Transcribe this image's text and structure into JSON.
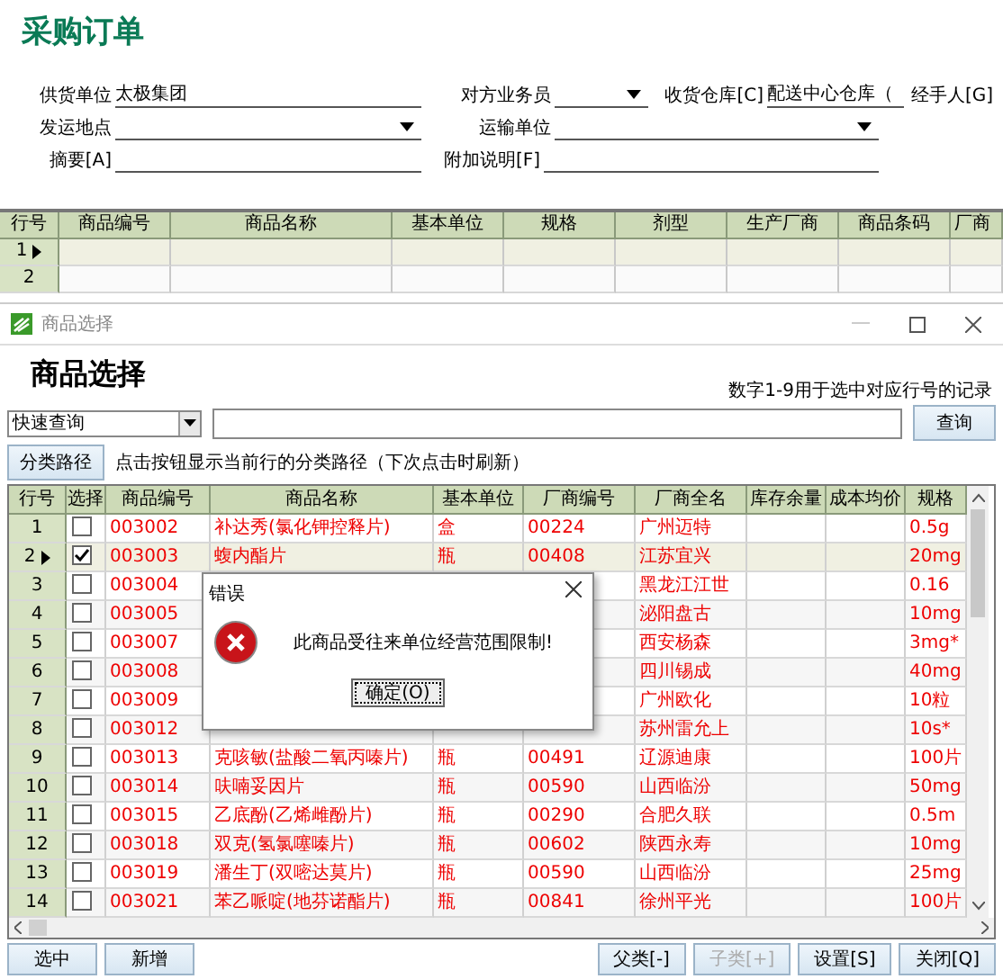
{
  "page_title": "采购订单",
  "form_rows": [
    [
      {
        "label": "供货单位",
        "value": "太极集团",
        "kind": "text"
      },
      {
        "label": "对方业务员",
        "kind": "dropdown"
      },
      {
        "label": "收货仓库[C]",
        "value": "配送中心仓库（",
        "kind": "text"
      },
      {
        "label": "经手人[G]",
        "kind": "cut"
      }
    ],
    [
      {
        "label": "发运地点",
        "kind": "dropdown"
      },
      {
        "label": "运输单位",
        "kind": "dropdown"
      }
    ],
    [
      {
        "label": "摘要[A]",
        "kind": "text"
      },
      {
        "label": "附加说明[F]",
        "kind": "text"
      }
    ]
  ],
  "order_grid": {
    "columns": [
      "行号",
      "商品编号",
      "商品名称",
      "基本单位",
      "规格",
      "剂型",
      "生产厂商",
      "商品条码",
      "厂商"
    ],
    "rows": [
      {
        "row": "1",
        "selected": true
      },
      {
        "row": "2",
        "selected": false
      }
    ]
  },
  "picker_window": {
    "title": "商品选择",
    "heading": "商品选择",
    "hint": "数字1-9用于选中对应行号的记录",
    "search_mode": "快速查询",
    "search_button": "查询",
    "category_button": "分类路径",
    "category_hint": "点击按钮显示当前行的分类路径（下次点击时刷新）",
    "columns": [
      "行号",
      "选择",
      "商品编号",
      "商品名称",
      "基本单位",
      "厂商编号",
      "厂商全名",
      "库存余量",
      "成本均价",
      "规格"
    ],
    "rows": [
      {
        "row": "1",
        "checked": false,
        "selected": false,
        "code": "003002",
        "name": "补达秀(氯化钾控释片)",
        "unit": "盒",
        "vendor_code": "00224",
        "vendor": "广州迈特",
        "spec": "0.5g"
      },
      {
        "row": "2",
        "checked": true,
        "selected": true,
        "code": "003003",
        "name": "蝮内酯片",
        "unit": "瓶",
        "vendor_code": "00408",
        "vendor": "江苏宜兴",
        "spec": "20mg"
      },
      {
        "row": "3",
        "checked": false,
        "selected": false,
        "code": "003004",
        "vendor": "黑龙江江世",
        "spec": "0.16"
      },
      {
        "row": "4",
        "checked": false,
        "selected": false,
        "code": "003005",
        "vendor": "泌阳盘古",
        "spec": "10mg"
      },
      {
        "row": "5",
        "checked": false,
        "selected": false,
        "code": "003007",
        "vendor": "西安杨森",
        "spec": "3mg*"
      },
      {
        "row": "6",
        "checked": false,
        "selected": false,
        "code": "003008",
        "vendor": "四川锡成",
        "spec": "40mg"
      },
      {
        "row": "7",
        "checked": false,
        "selected": false,
        "code": "003009",
        "vendor": "广州欧化",
        "spec": "10粒"
      },
      {
        "row": "8",
        "checked": false,
        "selected": false,
        "code": "003012",
        "vendor": "苏州雷允上",
        "spec": "10s*"
      },
      {
        "row": "9",
        "checked": false,
        "selected": false,
        "code": "003013",
        "name": "克咳敏(盐酸二氧丙嗪片)",
        "unit": "瓶",
        "vendor_code": "00491",
        "vendor": "辽源迪康",
        "spec": "100片"
      },
      {
        "row": "10",
        "checked": false,
        "selected": false,
        "code": "003014",
        "name": "呋喃妥因片",
        "unit": "瓶",
        "vendor_code": "00590",
        "vendor": "山西临汾",
        "spec": "50mg"
      },
      {
        "row": "11",
        "checked": false,
        "selected": false,
        "code": "003015",
        "name": "乙底酚(乙烯雌酚片)",
        "unit": "瓶",
        "vendor_code": "00290",
        "vendor": "合肥久联",
        "spec": "0.5m"
      },
      {
        "row": "12",
        "checked": false,
        "selected": false,
        "code": "003018",
        "name": "双克(氢氯噻嗪片)",
        "unit": "瓶",
        "vendor_code": "00602",
        "vendor": "陕西永寿",
        "spec": "10mg"
      },
      {
        "row": "13",
        "checked": false,
        "selected": false,
        "code": "003019",
        "name": "潘生丁(双嘧达莫片)",
        "unit": "瓶",
        "vendor_code": "00590",
        "vendor": "山西临汾",
        "spec": "25mg"
      },
      {
        "row": "14",
        "checked": false,
        "selected": false,
        "code": "003021",
        "name": "苯乙哌啶(地芬诺酯片)",
        "unit": "瓶",
        "vendor_code": "00841",
        "vendor": "徐州平光",
        "spec": "100片"
      }
    ],
    "left_buttons": [
      {
        "label": "选中",
        "disabled": false
      },
      {
        "label": "新增",
        "disabled": false
      }
    ],
    "right_buttons": [
      {
        "label": "父类[-]",
        "disabled": false
      },
      {
        "label": "子类[+]",
        "disabled": true
      },
      {
        "label": "设置[S]",
        "disabled": false
      },
      {
        "label": "关闭[Q]",
        "disabled": false
      }
    ]
  },
  "error_dialog": {
    "title": "错误",
    "message": "此商品受往来单位经营范围限制!",
    "button": "确定(O)"
  }
}
